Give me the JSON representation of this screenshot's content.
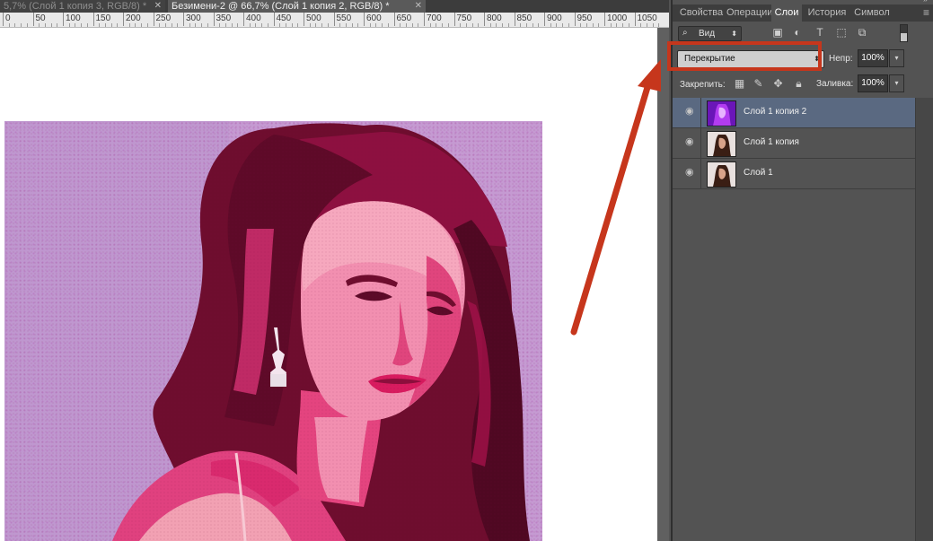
{
  "document_tabs": [
    {
      "label": "5,7% (Слой 1 копия 3, RGB/8) *",
      "active": false
    },
    {
      "label": "Безимени-2 @ 66,7% (Слой 1 копия 2, RGB/8) *",
      "active": true
    }
  ],
  "ruler": {
    "labels": [
      "0",
      "50",
      "100",
      "150",
      "200",
      "250",
      "300",
      "350",
      "400",
      "450",
      "500",
      "550",
      "600",
      "650",
      "700",
      "750",
      "800",
      "850",
      "900",
      "950",
      "1000",
      "1050"
    ]
  },
  "panel": {
    "tabs": [
      "Свойства",
      "Операции",
      "Слои",
      "История",
      "Символ"
    ],
    "active_tab": "Слои",
    "menu_icon": "panel-menu-icon",
    "filter": {
      "label": "Вид",
      "icon": "search-icon"
    },
    "filter_icons": [
      "image-filter-icon",
      "adjustment-filter-icon",
      "type-filter-icon",
      "shape-filter-icon",
      "smart-object-filter-icon"
    ],
    "blend_mode": "Перекрытие",
    "opacity_label": "Непр:",
    "opacity_value": "100%",
    "lock_label": "Закрепить:",
    "lock_icons": [
      "lock-transparent-icon",
      "lock-paint-icon",
      "lock-move-icon",
      "lock-all-icon"
    ],
    "fill_label": "Заливка:",
    "fill_value": "100%"
  },
  "layers": [
    {
      "name": "Слой 1 копия 2",
      "visible": true,
      "selected": true
    },
    {
      "name": "Слой 1 копия",
      "visible": true,
      "selected": false
    },
    {
      "name": "Слой 1",
      "visible": true,
      "selected": false
    }
  ],
  "annotation": {
    "color": "#c6361c",
    "target": "blend-mode-select"
  }
}
